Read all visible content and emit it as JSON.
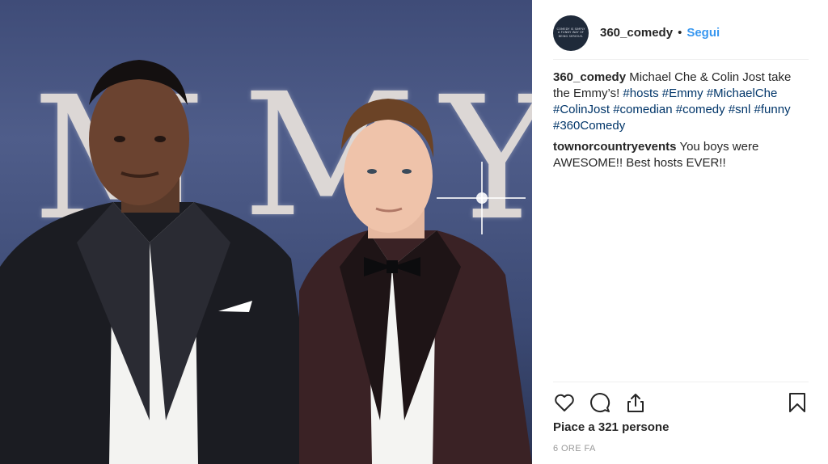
{
  "post": {
    "photo": {
      "backdrop_text": [
        "M",
        "M",
        "Y"
      ]
    }
  },
  "header": {
    "avatar_text": [
      "COMEDY IS SIMPLY",
      "A FUNNY WAY OF",
      "BEING SERIOUS."
    ],
    "username": "360_comedy",
    "separator": "•",
    "follow_label": "Segui"
  },
  "comments": [
    {
      "user": "360_comedy",
      "text": "Michael Che & Colin Jost take the Emmy’s!",
      "hashtags": [
        "#hosts",
        "#Emmy",
        "#MichaelChe",
        "#ColinJost",
        "#comedian",
        "#comedy",
        "#snl",
        "#funny",
        "#360Comedy"
      ]
    },
    {
      "user": "townorcountryevents",
      "text": "You boys were AWESOME!! Best hosts EVER!!"
    }
  ],
  "actions": {
    "icons": [
      "heart-icon",
      "comment-icon",
      "share-icon",
      "bookmark-icon"
    ]
  },
  "likes_text": "Piace a 321 persone",
  "timestamp": "6 ORE FA",
  "colors": {
    "link": "#003569",
    "follow": "#3897f0",
    "text": "#262626",
    "muted": "#999999",
    "backdrop": "#4f5d8a"
  }
}
